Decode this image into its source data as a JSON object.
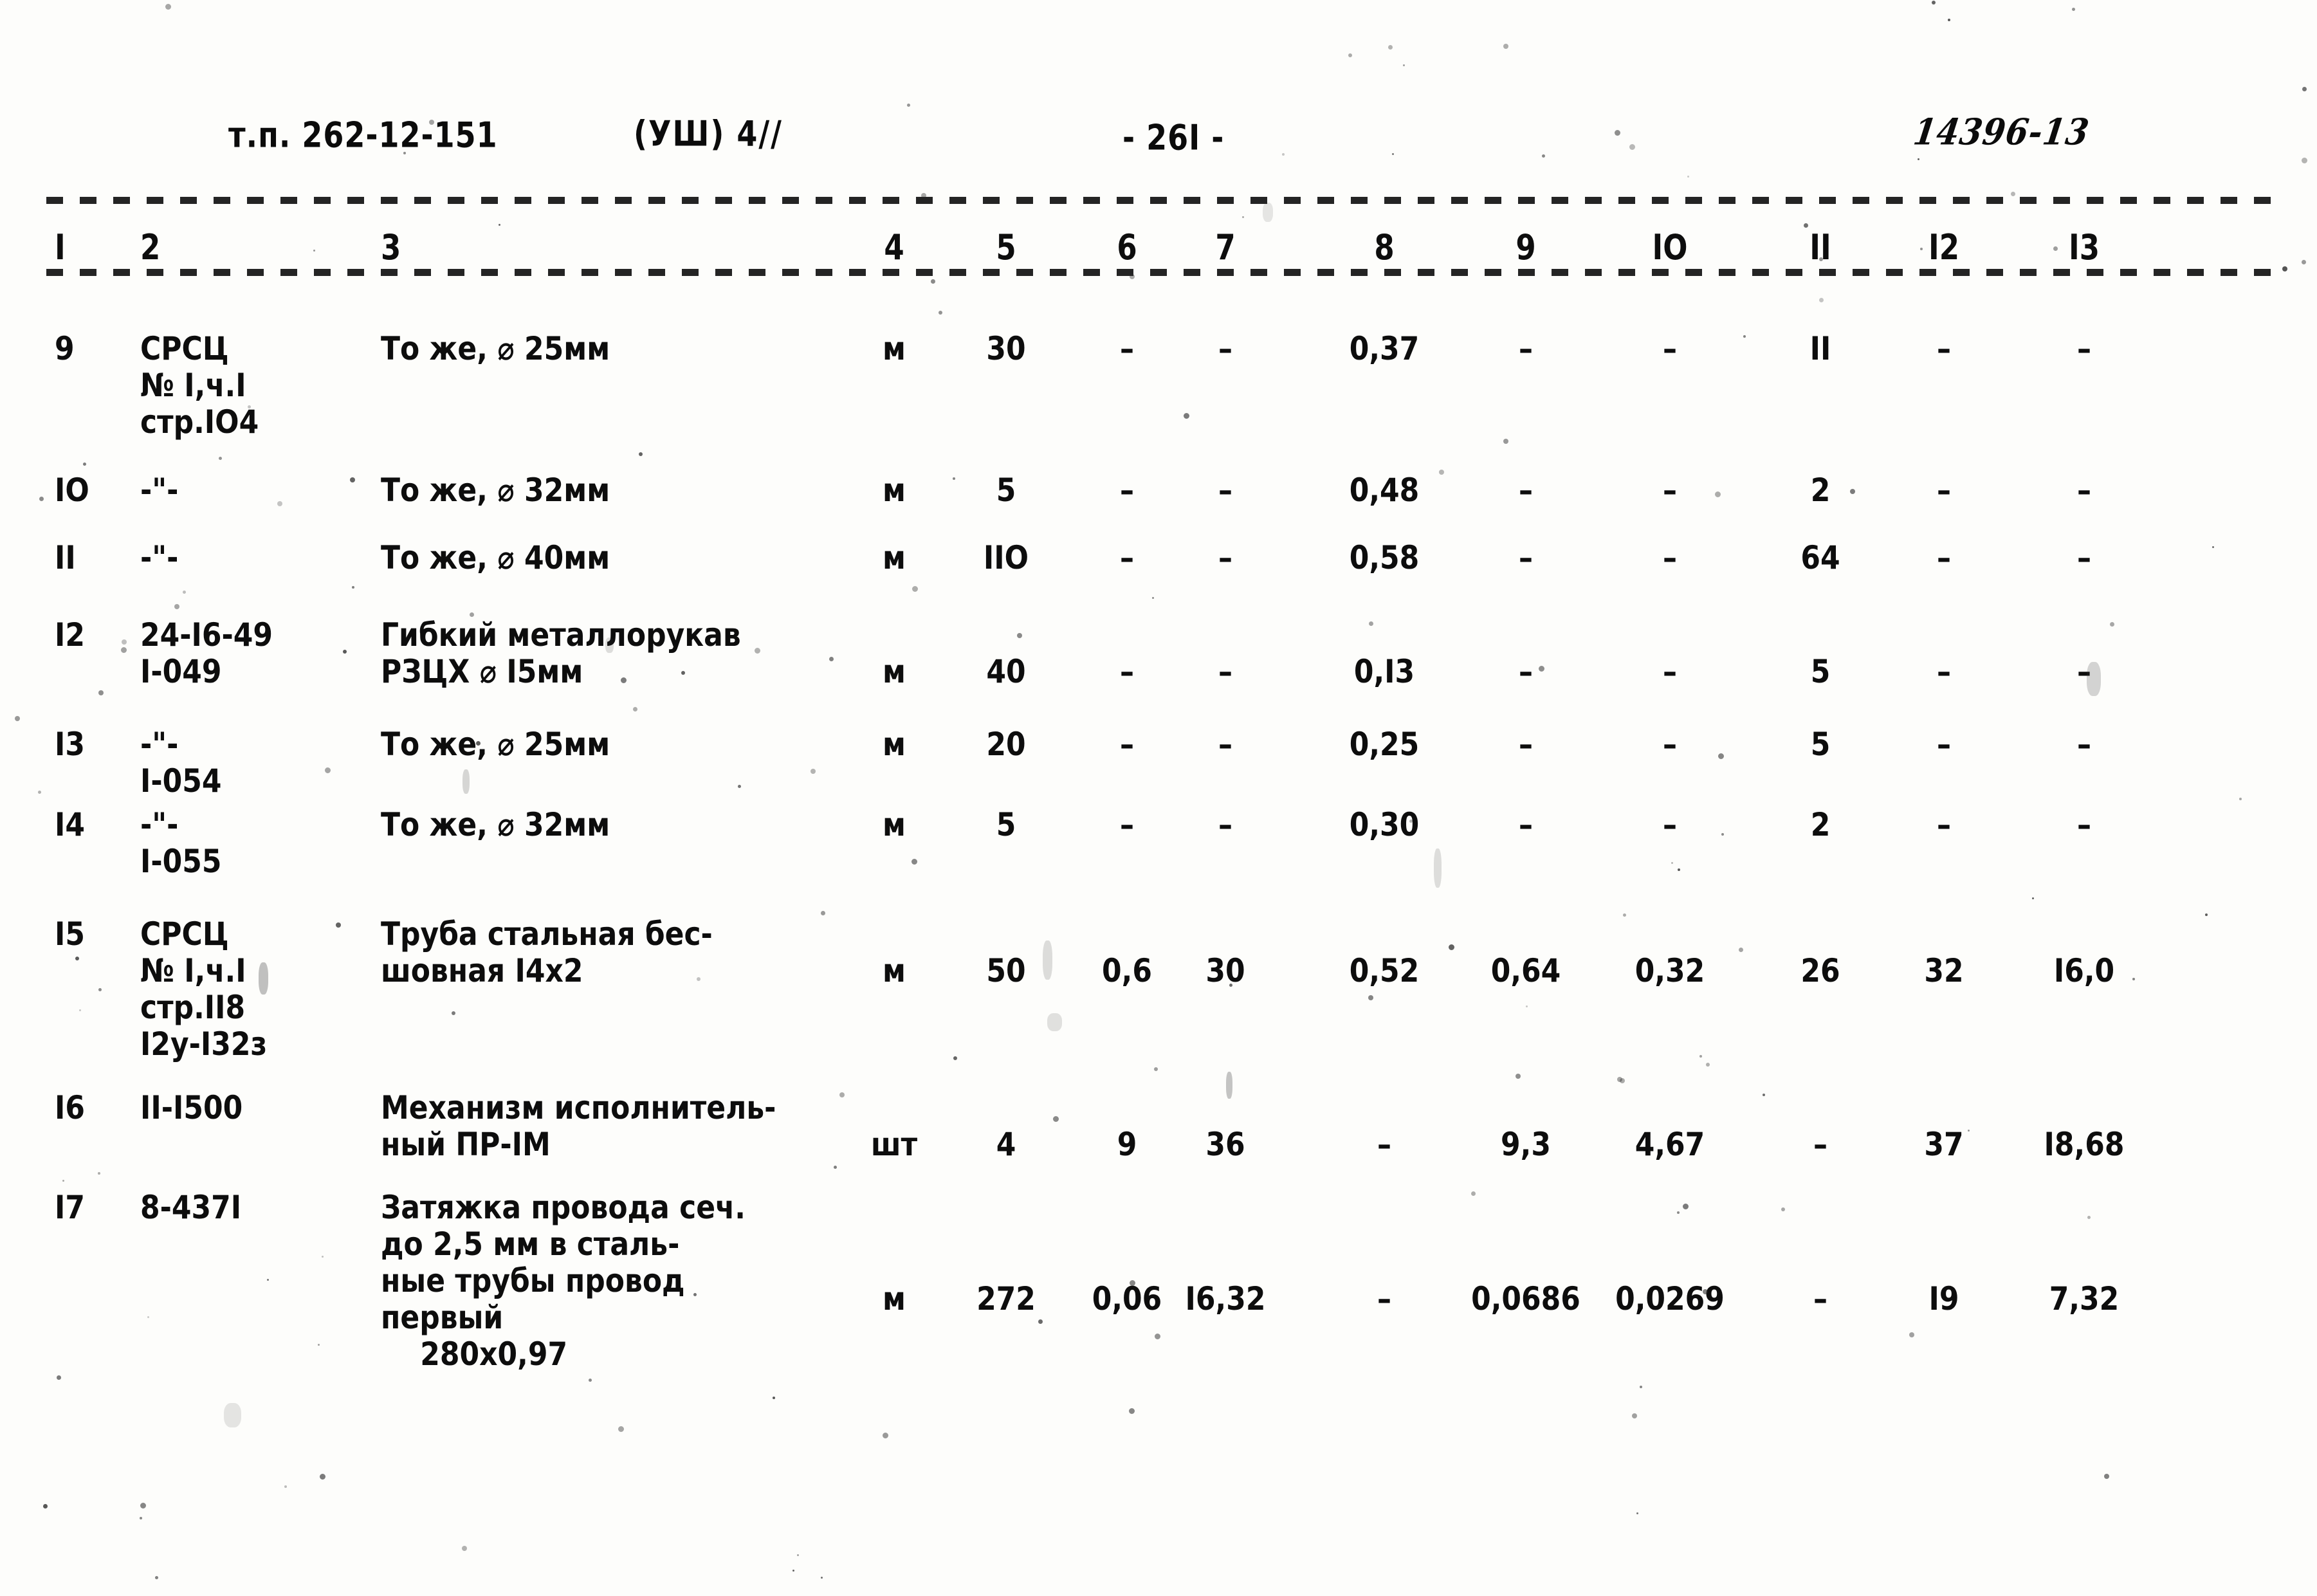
{
  "header": {
    "doc_code": "т.п. 262-12-151",
    "section_code": "(УШ) 4//",
    "page_number": "- 26I -",
    "stamp_number": "14396-13"
  },
  "table": {
    "column_headers": [
      "I",
      "2",
      "3",
      "4",
      "5",
      "6",
      "7",
      "8",
      "9",
      "IO",
      "II",
      "I2",
      "I3"
    ],
    "rows": [
      {
        "c1": "9",
        "c2": [
          "СРСЦ",
          "№ I,ч.I",
          "стр.IO4"
        ],
        "c3": [
          "То же, ⌀ 25мм"
        ],
        "c4": "м",
        "c5": "30",
        "c6": "–",
        "c7": "–",
        "c8": "0,37",
        "c9": "–",
        "c10": "–",
        "c11": "II",
        "c12": "–",
        "c13": "–"
      },
      {
        "c1": "IO",
        "c2": [
          "-\"-"
        ],
        "c3": [
          "То же, ⌀ 32мм"
        ],
        "c4": "м",
        "c5": "5",
        "c6": "–",
        "c7": "–",
        "c8": "0,48",
        "c9": "–",
        "c10": "–",
        "c11": "2",
        "c12": "–",
        "c13": "–"
      },
      {
        "c1": "II",
        "c2": [
          "-\"-"
        ],
        "c3": [
          "То же, ⌀ 40мм"
        ],
        "c4": "м",
        "c5": "IIO",
        "c6": "–",
        "c7": "–",
        "c8": "0,58",
        "c9": "–",
        "c10": "–",
        "c11": "64",
        "c12": "–",
        "c13": "–"
      },
      {
        "c1": "I2",
        "c2": [
          "24-I6-49",
          "I-049"
        ],
        "c3": [
          "Гибкий металлорукав",
          "РЗЦХ ⌀ I5мм"
        ],
        "c4": "м",
        "c5": "40",
        "c6": "–",
        "c7": "–",
        "c8": "0,I3",
        "c9": "–",
        "c10": "–",
        "c11": "5",
        "c12": "–",
        "c13": "–"
      },
      {
        "c1": "I3",
        "c2": [
          "-\"-",
          "I-054"
        ],
        "c3": [
          "То же, ⌀ 25мм"
        ],
        "c4": "м",
        "c5": "20",
        "c6": "–",
        "c7": "–",
        "c8": "0,25",
        "c9": "–",
        "c10": "–",
        "c11": "5",
        "c12": "–",
        "c13": "–"
      },
      {
        "c1": "I4",
        "c2": [
          "-\"-",
          "I-055"
        ],
        "c3": [
          "То же, ⌀ 32мм"
        ],
        "c4": "м",
        "c5": "5",
        "c6": "–",
        "c7": "–",
        "c8": "0,30",
        "c9": "–",
        "c10": "–",
        "c11": "2",
        "c12": "–",
        "c13": "–"
      },
      {
        "c1": "I5",
        "c2": [
          "СРСЦ",
          "№ I,ч.I",
          "стр.II8",
          "I2у-I32з"
        ],
        "c3": [
          "Труба стальная бес-",
          "шовная I4х2"
        ],
        "c4": "м",
        "c5": "50",
        "c6": "0,6",
        "c7": "30",
        "c8": "0,52",
        "c9": "0,64",
        "c10": "0,32",
        "c11": "26",
        "c12": "32",
        "c13": "I6,0"
      },
      {
        "c1": "I6",
        "c2": [
          "II-I500"
        ],
        "c3": [
          "Механизм исполнитель-",
          "ный ПР-IМ"
        ],
        "c4": "шт",
        "c5": "4",
        "c6": "9",
        "c7": "36",
        "c8": "–",
        "c9": "9,3",
        "c10": "4,67",
        "c11": "–",
        "c12": "37",
        "c13": "I8,68"
      },
      {
        "c1": "I7",
        "c2": [
          "8-437I"
        ],
        "c3": [
          "Затяжка провода сеч.",
          "до 2,5 мм в сталь-",
          "ные трубы провод",
          "первый",
          "    280х0,97"
        ],
        "c4": "м",
        "c5": "272",
        "c6": "0,06",
        "c7": "I6,32",
        "c8": "–",
        "c9": "0,0686",
        "c10": "0,0269",
        "c11": "–",
        "c12": "I9",
        "c13": "7,32"
      }
    ]
  }
}
